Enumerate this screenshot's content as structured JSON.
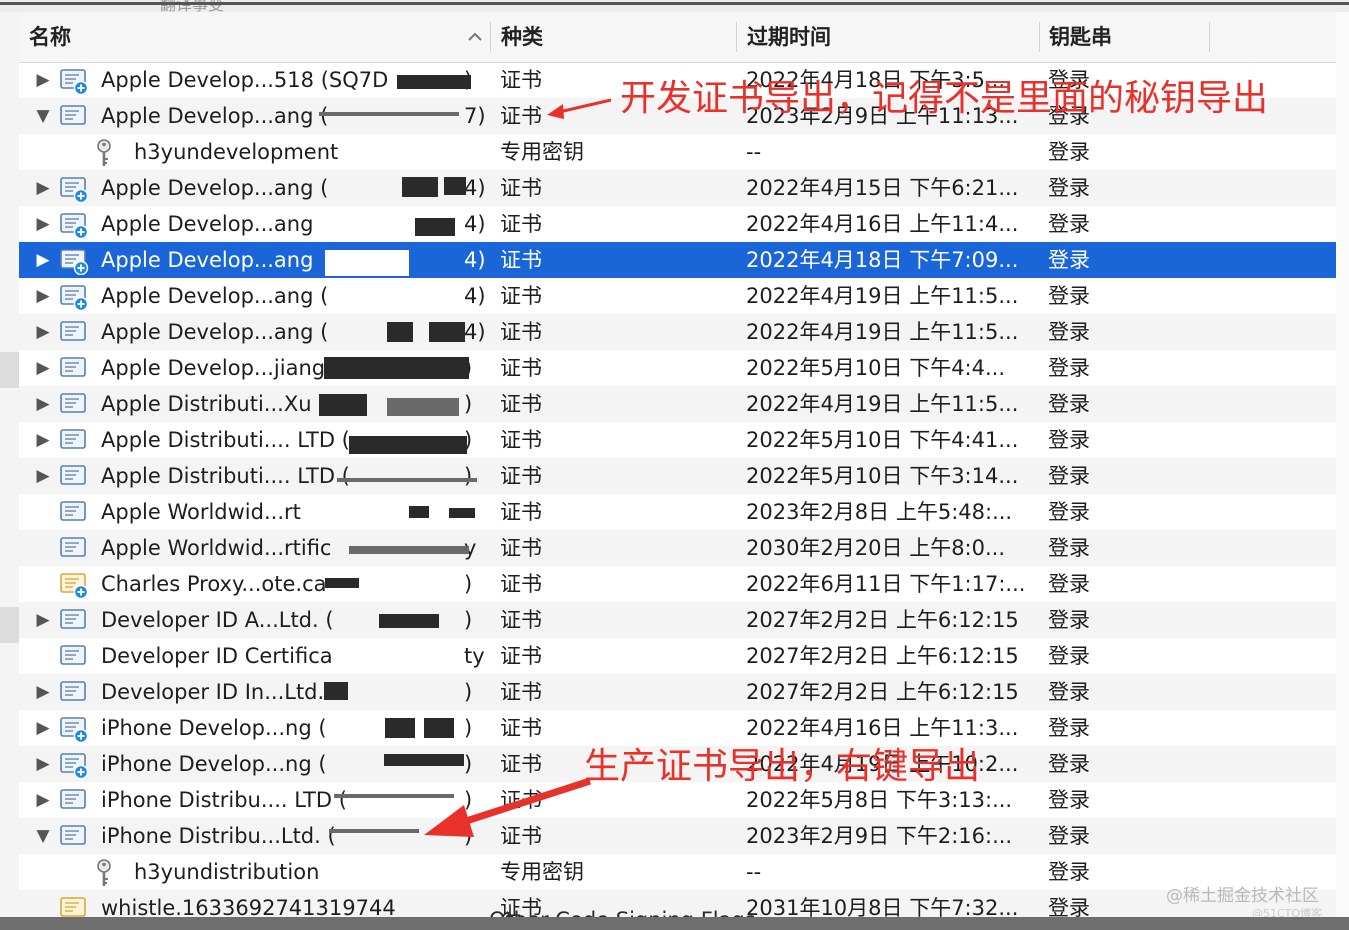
{
  "header": {
    "name": "名称",
    "kind": "种类",
    "expires": "过期时间",
    "keychain": "钥匙串",
    "sort_icon": "chevron-up-icon"
  },
  "top_fragment": "翻译事变",
  "rows": [
    {
      "name": "Apple Develop...518 (SQ7D",
      "tail": ")",
      "kind": "证书",
      "expires": "2022年4月18日 下午3:5...",
      "keychain": "登录",
      "disclosure": "collapsed",
      "icon": "certificate-plus-icon"
    },
    {
      "name": "Apple Develop...ang (",
      "tail": "7)",
      "kind": "证书",
      "expires": "2023年2月9日 上午11:13...",
      "keychain": "登录",
      "disclosure": "expanded",
      "icon": "certificate-icon"
    },
    {
      "name": "h3yundevelopment",
      "tail": "",
      "kind": "专用密钥",
      "expires": "--",
      "keychain": "登录",
      "disclosure": "none",
      "icon": "key-icon"
    },
    {
      "name": "Apple Develop...ang (",
      "tail": "4)",
      "kind": "证书",
      "expires": "2022年4月15日 下午6:21...",
      "keychain": "登录",
      "disclosure": "collapsed",
      "icon": "certificate-plus-icon"
    },
    {
      "name": "Apple Develop...ang",
      "tail": "4)",
      "kind": "证书",
      "expires": "2022年4月16日 上午11:4...",
      "keychain": "登录",
      "disclosure": "collapsed",
      "icon": "certificate-plus-icon"
    },
    {
      "name": "Apple Develop...ang",
      "tail": "4)",
      "kind": "证书",
      "expires": "2022年4月18日 下午7:09...",
      "keychain": "登录",
      "disclosure": "collapsed",
      "icon": "certificate-plus-icon",
      "selected": true
    },
    {
      "name": "Apple Develop...ang (",
      "tail": "4)",
      "kind": "证书",
      "expires": "2022年4月19日 上午11:5...",
      "keychain": "登录",
      "disclosure": "collapsed",
      "icon": "certificate-plus-icon"
    },
    {
      "name": "Apple Develop...ang (",
      "tail": "4)",
      "kind": "证书",
      "expires": "2022年4月19日 上午11:5...",
      "keychain": "登录",
      "disclosure": "collapsed",
      "icon": "certificate-icon"
    },
    {
      "name": "Apple Develop...jiang (",
      "tail": ")",
      "kind": "证书",
      "expires": "2022年5月10日 下午4:4...",
      "keychain": "登录",
      "disclosure": "collapsed",
      "icon": "certificate-icon"
    },
    {
      "name": "Apple Distributi...Xu (",
      "tail": ")",
      "kind": "证书",
      "expires": "2022年4月19日 上午11:5...",
      "keychain": "登录",
      "disclosure": "collapsed",
      "icon": "certificate-icon"
    },
    {
      "name": "Apple Distributi.... LTD (",
      "tail": ")",
      "kind": "证书",
      "expires": "2022年5月10日 下午4:41...",
      "keychain": "登录",
      "disclosure": "collapsed",
      "icon": "certificate-icon"
    },
    {
      "name": "Apple Distributi.... LTD (",
      "tail": ")",
      "kind": "证书",
      "expires": "2022年5月10日 下午3:14...",
      "keychain": "登录",
      "disclosure": "collapsed",
      "icon": "certificate-icon"
    },
    {
      "name": "Apple Worldwid...rt",
      "tail": "",
      "kind": "证书",
      "expires": "2023年2月8日 上午5:48:...",
      "keychain": "登录",
      "disclosure": "none",
      "icon": "certificate-icon"
    },
    {
      "name": "Apple Worldwid...rtific",
      "tail": "y",
      "kind": "证书",
      "expires": "2030年2月20日 上午8:0...",
      "keychain": "登录",
      "disclosure": "none",
      "icon": "certificate-icon"
    },
    {
      "name": "Charles Proxy...ote.ca",
      "tail": ")",
      "kind": "证书",
      "expires": "2022年6月11日 下午1:17:...",
      "keychain": "登录",
      "disclosure": "none",
      "icon": "certificate-gold-plus-icon"
    },
    {
      "name": "Developer ID A...Ltd. (",
      "tail": ")",
      "kind": "证书",
      "expires": "2027年2月2日 上午6:12:15",
      "keychain": "登录",
      "disclosure": "collapsed",
      "icon": "certificate-icon"
    },
    {
      "name": "Developer ID Certifica",
      "tail": "ty",
      "kind": "证书",
      "expires": "2027年2月2日 上午6:12:15",
      "keychain": "登录",
      "disclosure": "none",
      "icon": "certificate-icon"
    },
    {
      "name": "Developer ID In...Ltd.",
      "tail": ")",
      "kind": "证书",
      "expires": "2027年2月2日 上午6:12:15",
      "keychain": "登录",
      "disclosure": "collapsed",
      "icon": "certificate-icon"
    },
    {
      "name": "iPhone Develop...ng (",
      "tail": ")",
      "kind": "证书",
      "expires": "2022年4月16日 上午11:3...",
      "keychain": "登录",
      "disclosure": "collapsed",
      "icon": "certificate-plus-icon"
    },
    {
      "name": "iPhone Develop...ng (",
      "tail": ")",
      "kind": "证书",
      "expires": "2022年4月19日 上午10:2...",
      "keychain": "登录",
      "disclosure": "collapsed",
      "icon": "certificate-plus-icon"
    },
    {
      "name": "iPhone Distribu.... LTD (",
      "tail": ")",
      "kind": "证书",
      "expires": "2022年5月8日 下午3:13:...",
      "keychain": "登录",
      "disclosure": "collapsed",
      "icon": "certificate-icon"
    },
    {
      "name": "iPhone Distribu...Ltd. (",
      "tail": ")",
      "kind": "证书",
      "expires": "2023年2月9日 下午2:16:...",
      "keychain": "登录",
      "disclosure": "expanded",
      "icon": "certificate-icon"
    },
    {
      "name": "h3yundistribution",
      "tail": "",
      "kind": "专用密钥",
      "expires": "--",
      "keychain": "登录",
      "disclosure": "none",
      "icon": "key-icon"
    },
    {
      "name": "whistle.1633692741319744",
      "tail": "",
      "kind": "证书",
      "expires": "2031年10月8日 下午7:32...",
      "keychain": "登录",
      "disclosure": "none",
      "icon": "certificate-gold-icon"
    }
  ],
  "annotations": {
    "dev_note": "开发证书导出，记得不是里面的秘钥导出",
    "prod_note": "生产证书导出，右键导出",
    "color": "#e8312a"
  },
  "bottom_overlay": "Other Code Signing Flags",
  "watermark": "@稀土掘金技术社区",
  "watermark2": "@51CTO博客",
  "colors": {
    "selection": "#1a65d8",
    "alt_row": "#f4f4f5",
    "header_bg": "#f6f6f6"
  }
}
